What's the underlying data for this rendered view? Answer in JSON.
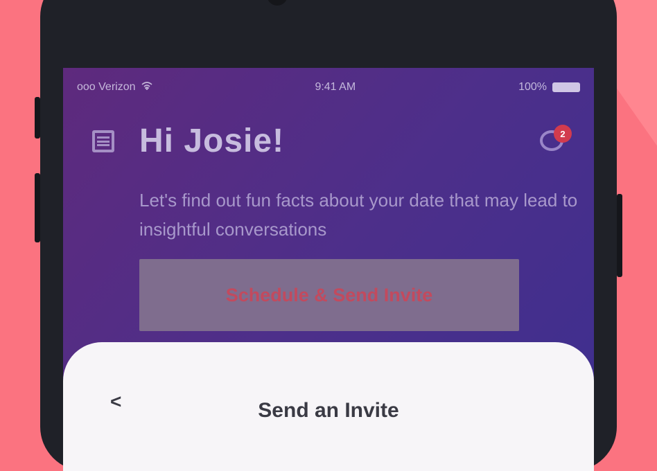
{
  "status_bar": {
    "carrier": "ooo Verizon",
    "wifi_icon": "wifi-icon",
    "time": "9:41 AM",
    "battery_level": "100%",
    "battery_icon": "battery-icon"
  },
  "header": {
    "menu_icon": "hamburger-menu-icon",
    "greeting": "Hi Josie!",
    "chat_icon": "chat-bubble-icon",
    "notification_count": "2"
  },
  "subtitle": "Let's find out fun facts about your date that may lead to insightful conversations",
  "cta_label": "Schedule & Send Invite",
  "sheet": {
    "back_label": "<",
    "title": "Send an Invite"
  },
  "colors": {
    "background": "#fb7380",
    "screen_gradient_start": "#5e2a7d",
    "screen_gradient_end": "#3d2f8f",
    "cta_text": "#c24a5e",
    "badge": "#d23b4e",
    "sheet": "#f7f5f8"
  }
}
